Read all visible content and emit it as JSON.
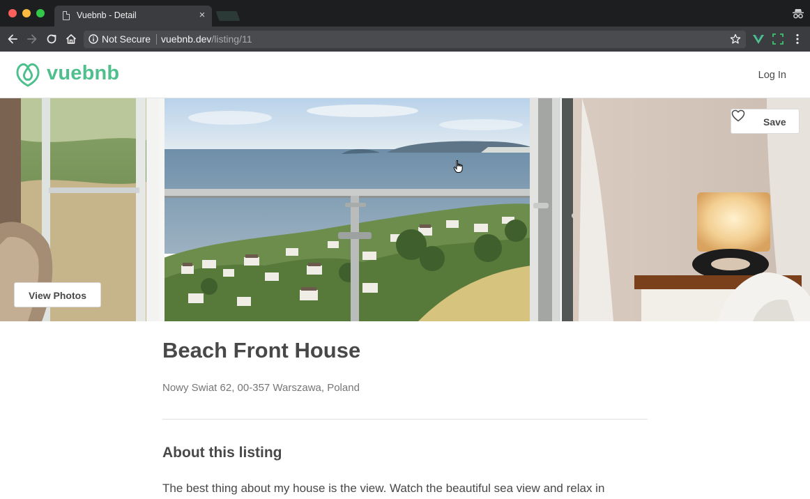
{
  "browser": {
    "tab_title": "Vuebnb - Detail",
    "tab_close": "×",
    "security_label": "Not Secure",
    "url_host": "vuebnb.dev",
    "url_path": "/listing/11",
    "icons": [
      "back-icon",
      "forward-icon",
      "reload-icon",
      "home-icon",
      "info-icon",
      "star-icon",
      "vue-devtools-icon",
      "screenshot-extension-icon",
      "menu-icon",
      "incognito-icon"
    ]
  },
  "header": {
    "logo_text": "vuebnb",
    "login_label": "Log In",
    "brand_color": "#4fc08d"
  },
  "hero": {
    "save_label": "Save",
    "view_photos_label": "View Photos"
  },
  "listing": {
    "title": "Beach Front House",
    "address": "Nowy Swiat 62, 00-357 Warszawa, Poland",
    "about_heading": "About this listing",
    "about_text": "The best thing about my house is the view. Watch the beautiful sea view and relax in"
  }
}
